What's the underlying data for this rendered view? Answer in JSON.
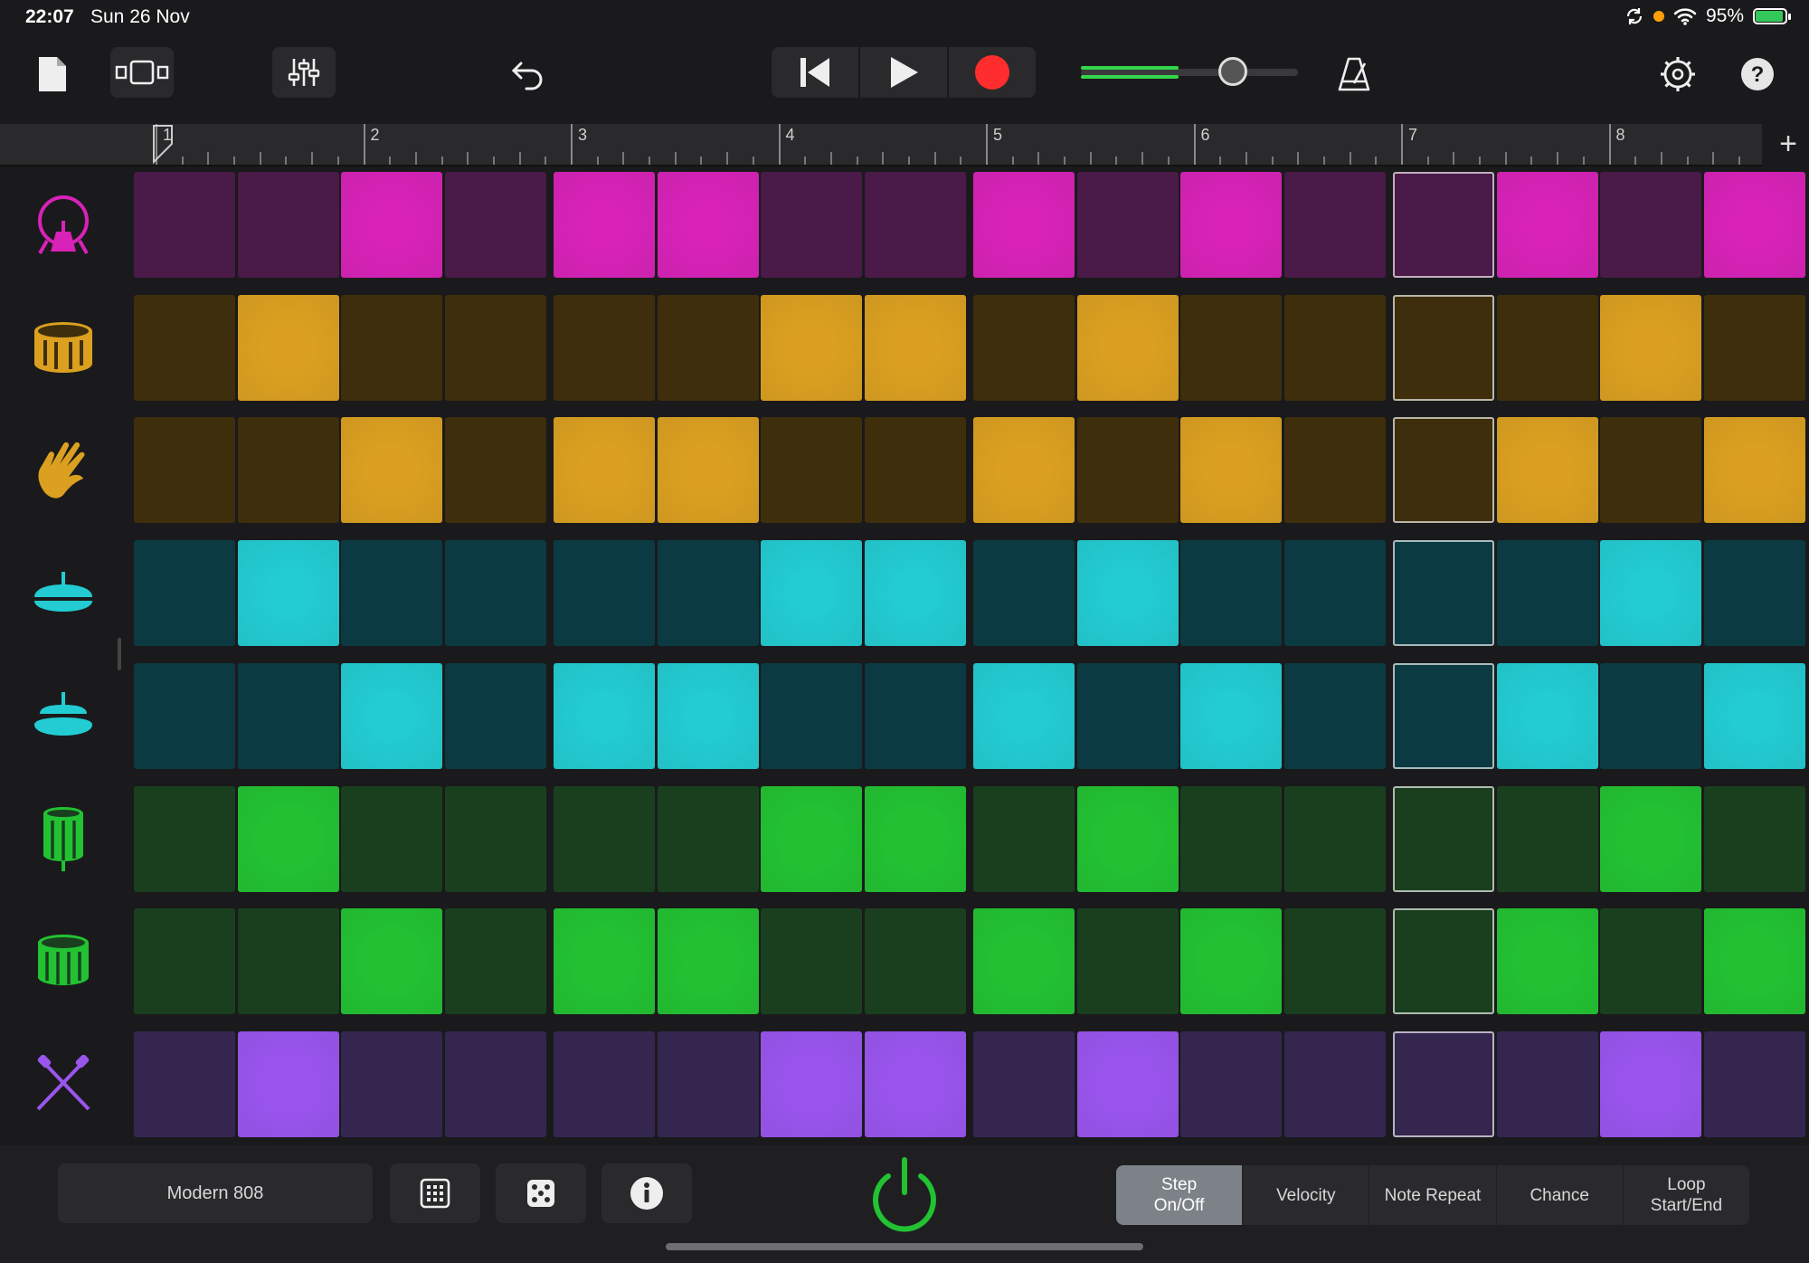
{
  "status": {
    "time": "22:07",
    "date": "Sun 26 Nov",
    "battery": "95%",
    "battery_level": 0.95
  },
  "toolbar": {
    "icons": [
      "document-icon",
      "tracks-view-icon",
      "mixer-icon",
      "undo-icon",
      "go-to-start-icon",
      "play-icon",
      "record-icon",
      "volume-slider",
      "metronome-icon",
      "settings-icon",
      "help-icon"
    ],
    "volume_level": 0.7,
    "meter_level": 0.45
  },
  "ruler": {
    "bars": [
      "1",
      "2",
      "3",
      "4",
      "5",
      "6",
      "7",
      "8"
    ],
    "add_label": "+"
  },
  "colors": {
    "magenta": {
      "off": "#4a1a48",
      "on": "#d822b8"
    },
    "amber": {
      "off": "#3e2e0c",
      "on": "#dba020"
    },
    "cyan": {
      "off": "#0b3a42",
      "on": "#22ccd2"
    },
    "green": {
      "off": "#1a3f1f",
      "on": "#22c232"
    },
    "purple": {
      "off": "#352650",
      "on": "#9a55ee"
    }
  },
  "current_step": 13,
  "tracks": [
    {
      "name": "kick-drum-icon",
      "color": "magenta",
      "steps": [
        0,
        0,
        1,
        0,
        1,
        1,
        0,
        0,
        1,
        0,
        1,
        0,
        0,
        1,
        0,
        1
      ]
    },
    {
      "name": "snare-drum-icon",
      "color": "amber",
      "steps": [
        0,
        1,
        0,
        0,
        0,
        0,
        1,
        1,
        0,
        1,
        0,
        0,
        0,
        0,
        1,
        0
      ]
    },
    {
      "name": "hand-clap-icon",
      "color": "amber",
      "steps": [
        0,
        0,
        1,
        0,
        1,
        1,
        0,
        0,
        1,
        0,
        1,
        0,
        0,
        1,
        0,
        1
      ]
    },
    {
      "name": "closed-hihat-icon",
      "color": "cyan",
      "steps": [
        0,
        1,
        0,
        0,
        0,
        0,
        1,
        1,
        0,
        1,
        0,
        0,
        0,
        0,
        1,
        0
      ]
    },
    {
      "name": "open-hihat-icon",
      "color": "cyan",
      "steps": [
        0,
        0,
        1,
        0,
        1,
        1,
        0,
        0,
        1,
        0,
        1,
        0,
        0,
        1,
        0,
        1
      ]
    },
    {
      "name": "high-tom-icon",
      "color": "green",
      "steps": [
        0,
        1,
        0,
        0,
        0,
        0,
        1,
        1,
        0,
        1,
        0,
        0,
        0,
        0,
        1,
        0
      ]
    },
    {
      "name": "low-tom-icon",
      "color": "green",
      "steps": [
        0,
        0,
        1,
        0,
        1,
        1,
        0,
        0,
        1,
        0,
        1,
        0,
        0,
        1,
        0,
        1
      ]
    },
    {
      "name": "percussion-sticks-icon",
      "color": "purple",
      "steps": [
        0,
        1,
        0,
        0,
        0,
        0,
        1,
        1,
        0,
        1,
        0,
        0,
        0,
        0,
        1,
        0
      ]
    }
  ],
  "bottom": {
    "kit_name": "Modern 808",
    "modes": [
      {
        "label": "Step\nOn/Off",
        "active": true
      },
      {
        "label": "Velocity",
        "active": false
      },
      {
        "label": "Note Repeat",
        "active": false
      },
      {
        "label": "Chance",
        "active": false
      },
      {
        "label": "Loop\nStart/End",
        "active": false
      }
    ]
  }
}
